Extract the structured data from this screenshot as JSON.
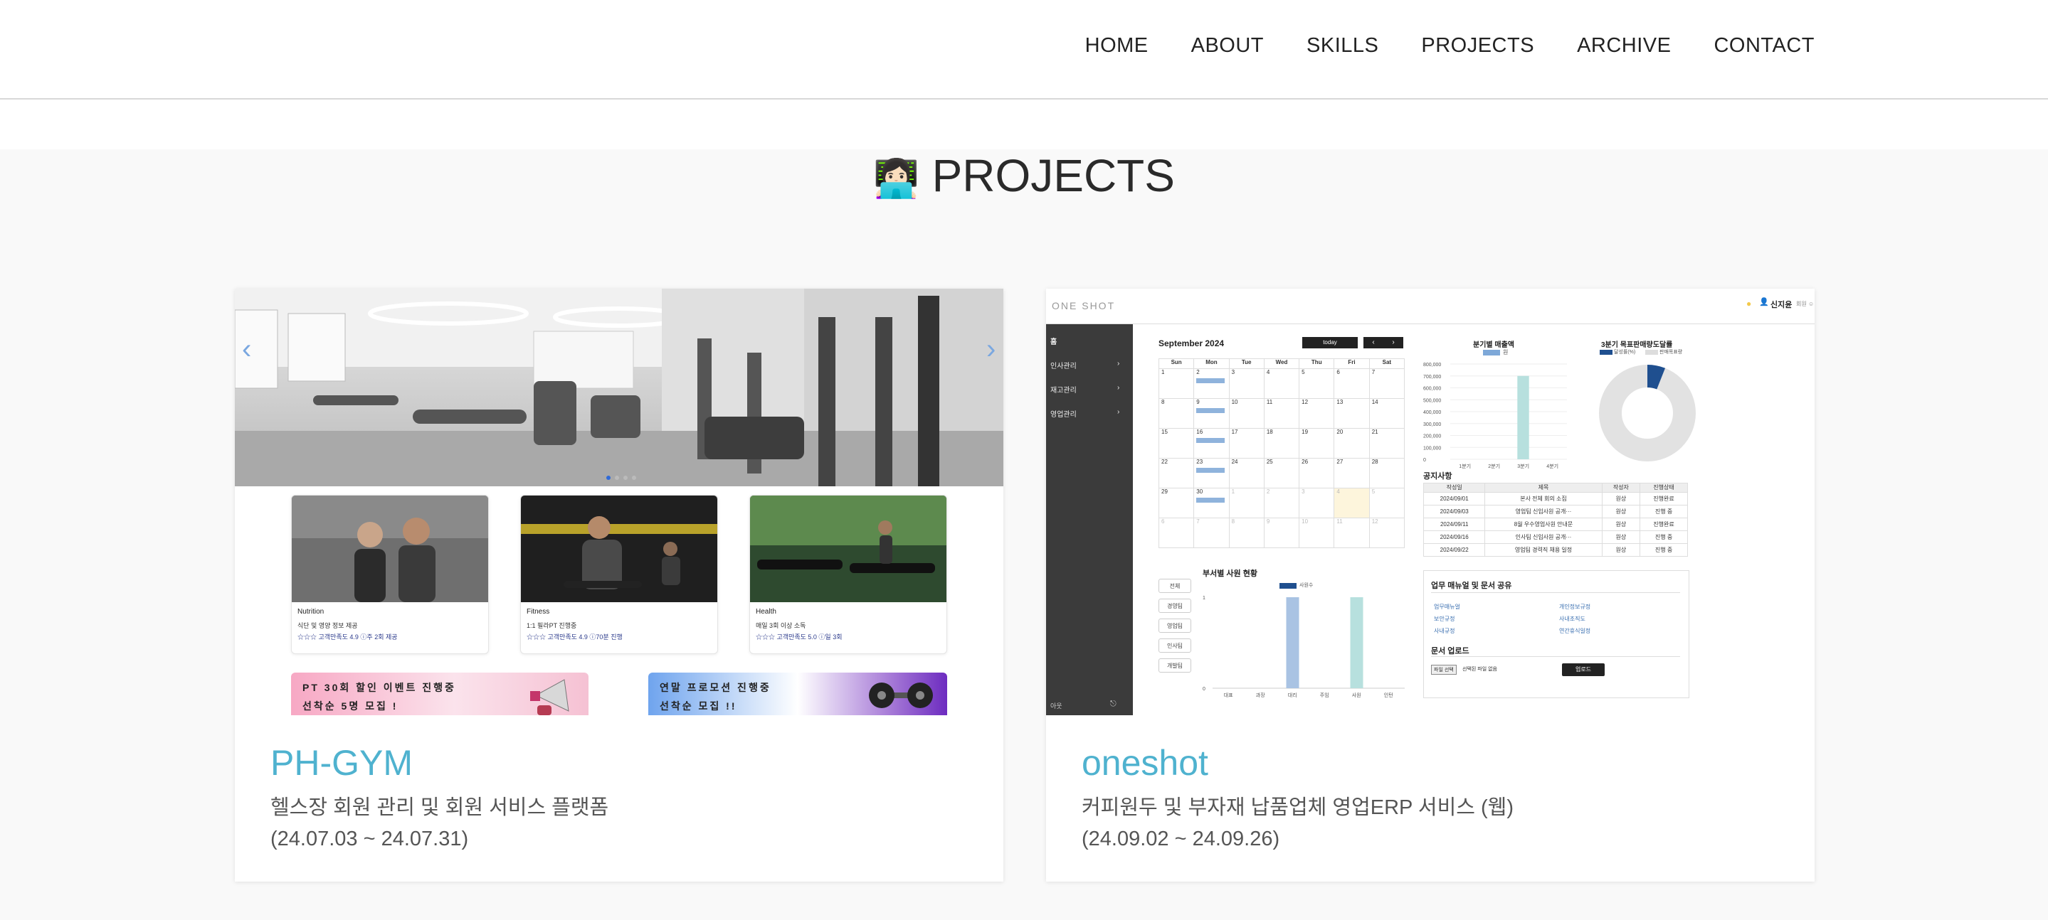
{
  "nav": {
    "links": [
      "HOME",
      "ABOUT",
      "SKILLS",
      "PROJECTS",
      "ARCHIVE",
      "CONTACT"
    ]
  },
  "section": {
    "emoji": "👩🏻‍💻",
    "title": "PROJECTS"
  },
  "projects": [
    {
      "title": "PH-GYM",
      "description": "헬스장 회원 관리 및 회원 서비스 플랫폼",
      "period": "(24.07.03 ~ 24.07.31)",
      "screenshot": {
        "carousel_prev": "‹",
        "carousel_next": "›",
        "cards": [
          {
            "name": "Nutrition",
            "desc": "식단 및 영양 정보 제공",
            "rating": "☆☆☆ 고객만족도 4.9 ⓘ주 2회 제공"
          },
          {
            "name": "Fitness",
            "desc": "1:1 필라PT 진행중",
            "rating": "☆☆☆ 고객만족도 4.9 ⓘ70분 진행"
          },
          {
            "name": "Health",
            "desc": "매일 3회 이상 소독",
            "rating": "☆☆☆ 고객만족도 5.0 ⓘ일 3회"
          }
        ],
        "banners": [
          {
            "line1": "PT 30회 할인 이벤트 진행중",
            "line2": "선착순 5명 모집 !"
          },
          {
            "line1": "연말 프로모션 진행중",
            "line2": "선착순 모집 !!"
          }
        ]
      }
    },
    {
      "title": "oneshot",
      "description": "커피원두 및 부자재 납품업체 영업ERP 서비스 (웹)",
      "period": "(24.09.02 ~ 24.09.26)",
      "screenshot": {
        "logo": "ONE SHOT",
        "user": "신지윤",
        "user_suffix": "회원 ☺",
        "sidebar": [
          "홈",
          "인사관리",
          "재고관리",
          "영업관리"
        ],
        "sidebar_bottom": "아웃",
        "calendar": {
          "month": "September 2024",
          "today": "today",
          "days": [
            "Sun",
            "Mon",
            "Tue",
            "Wed",
            "Thu",
            "Fri",
            "Sat"
          ],
          "weeks": [
            [
              "1",
              "2",
              "3",
              "4",
              "5",
              "6",
              "7"
            ],
            [
              "8",
              "9",
              "10",
              "11",
              "12",
              "13",
              "14"
            ],
            [
              "15",
              "16",
              "17",
              "18",
              "19",
              "20",
              "21"
            ],
            [
              "22",
              "23",
              "24",
              "25",
              "26",
              "27",
              "28"
            ],
            [
              "29",
              "30",
              "1",
              "2",
              "3",
              "4",
              "5"
            ],
            [
              "6",
              "7",
              "8",
              "9",
              "10",
              "11",
              "12"
            ]
          ]
        },
        "sales_chart": {
          "title": "분기별 매출액",
          "legend": "원",
          "categories": [
            "1분기",
            "2분기",
            "3분기",
            "4분기"
          ],
          "values": [
            0,
            0,
            700000,
            0
          ],
          "ticks": [
            "800,000",
            "700,000",
            "600,000",
            "500,000",
            "400,000",
            "300,000",
            "200,000",
            "100,000",
            "0"
          ]
        },
        "donut": {
          "title": "3분기 목표판매량도달률",
          "legend": [
            "달성률(%)",
            "판매목표량"
          ],
          "achieved_fraction": 0.06
        },
        "notice": {
          "title": "공지사항",
          "headers": [
            "작성일",
            "제목",
            "작성자",
            "진행상태"
          ],
          "rows": [
            [
              "2024/09/01",
              "본사 전체 회의 소집",
              "원상",
              "진행완료"
            ],
            [
              "2024/09/03",
              "영업팀 신입사원 공개···",
              "원상",
              "진행 중"
            ],
            [
              "2024/09/11",
              "8월 우수영업사원 안내문",
              "원상",
              "진행완료"
            ],
            [
              "2024/09/16",
              "인사팀 신입사원 공개···",
              "원상",
              "진행 중"
            ],
            [
              "2024/09/22",
              "영업팀 경력직 채용 일정",
              "원상",
              "진행 중"
            ]
          ]
        },
        "dept": {
          "title": "부서별 사원 현황",
          "legend": "사원수",
          "buttons": [
            "전체",
            "경영팀",
            "영업팀",
            "인사팀",
            "개발팀"
          ],
          "categories": [
            "대표",
            "과장",
            "대리",
            "주임",
            "사원",
            "인턴"
          ],
          "values": [
            0,
            0,
            1,
            0,
            1,
            0
          ],
          "colors": [
            "#a9c3e3",
            "#a9c3e3",
            "#a9c3e3",
            "#a9c3e3",
            "#b7e0de",
            "#b7e0de"
          ],
          "ticks": [
            "1",
            "0"
          ]
        },
        "docs": {
          "title": "업무 매뉴얼 및 문서 공유",
          "links_left": [
            "업무매뉴얼",
            "보안규정",
            "사내규정"
          ],
          "links_right": [
            "개인정보규정",
            "사내조직도",
            "연간휴식일정"
          ],
          "upload_title": "문서 업로드",
          "file_button": "파일 선택",
          "file_status": "선택된 파일 없음",
          "upload_button": "업로드"
        }
      }
    }
  ],
  "colors": {
    "accent": "#4fb2cf",
    "erp_sidebar": "#3b3b3b"
  }
}
